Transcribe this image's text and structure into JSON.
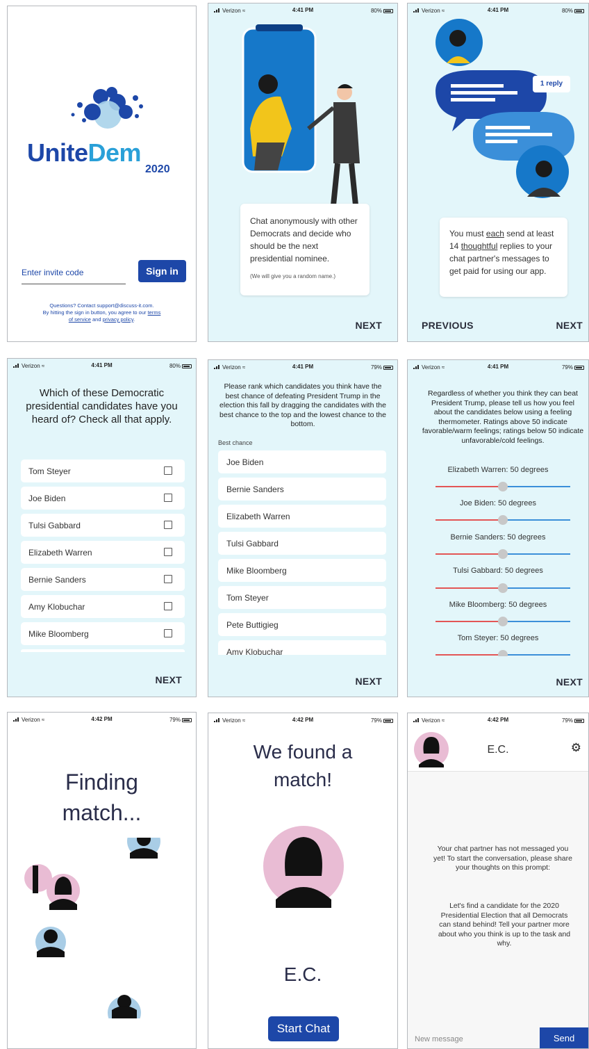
{
  "colors": {
    "brand": "#1d47a8",
    "light_bg": "#e3f6fa",
    "pink": "#e9bcd4",
    "blue_avatar": "#a9cde6",
    "slider_red": "#e35555",
    "slider_blue": "#3b8fd9"
  },
  "status": {
    "carrier": "Verizon",
    "time_441": "4:41 PM",
    "time_442": "4:42 PM",
    "batt_80": "80%",
    "batt_79": "79%"
  },
  "login": {
    "brand_part1": "Unite",
    "brand_part2": "Dem",
    "year": "2020",
    "invite_placeholder": "Enter invite code",
    "signin": "Sign in",
    "footer_line1": "Questions? Contact support@discuss-it.com.",
    "footer_line2a": "By hitting the sign in button, you agree to our ",
    "terms": "terms",
    "footer_line3a": "of service",
    "footer_line3b": " and ",
    "privacy": "privacy policy",
    "period": "."
  },
  "onboard1": {
    "text": "Chat anonymously with other Democrats and decide who should be the next presidential nominee.",
    "note": "(We will give you a random name.)",
    "next": "NEXT"
  },
  "onboard2": {
    "reply_badge": "1 reply",
    "t1": "You must ",
    "each": "each",
    "t2": " send at least 14 ",
    "thoughtful": "thoughtful",
    "t3": " replies to your chat partner's messages to get paid for using our app.",
    "previous": "PREVIOUS",
    "next": "NEXT"
  },
  "heard": {
    "question": "Which of these Democratic presidential candidates have you heard of? Check all that apply.",
    "candidates": [
      "Tom Steyer",
      "Joe Biden",
      "Tulsi Gabbard",
      "Elizabeth Warren",
      "Bernie Sanders",
      "Amy Klobuchar",
      "Mike Bloomberg"
    ],
    "next": "NEXT"
  },
  "rank": {
    "instructions": "Please rank which candidates you think have the best chance of defeating President Trump in the election this fall by dragging the candidates with the best chance to the top and the lowest chance to the bottom.",
    "best_chance": "Best chance",
    "candidates": [
      "Joe Biden",
      "Bernie Sanders",
      "Elizabeth Warren",
      "Tulsi Gabbard",
      "Mike Bloomberg",
      "Tom Steyer",
      "Pete Buttigieg",
      "Amy Klobuchar"
    ],
    "next": "NEXT"
  },
  "thermo": {
    "instructions": "Regardless of whether you think they can beat President Trump, please tell us how you feel about the candidates below using a feeling thermometer. Ratings above 50 indicate favorable/warm feelings; ratings below 50 indicate unfavorable/cold feelings.",
    "items": [
      {
        "label": "Elizabeth Warren: 50 degrees",
        "value": 50
      },
      {
        "label": "Joe Biden: 50 degrees",
        "value": 50
      },
      {
        "label": "Bernie Sanders: 50 degrees",
        "value": 50
      },
      {
        "label": "Tulsi Gabbard: 50 degrees",
        "value": 50
      },
      {
        "label": "Mike Bloomberg: 50 degrees",
        "value": 50
      },
      {
        "label": "Tom Steyer: 50 degrees",
        "value": 50
      }
    ],
    "next": "NEXT"
  },
  "finding": {
    "line1": "Finding",
    "line2": "match..."
  },
  "found": {
    "line1": "We found a",
    "line2": "match!",
    "name": "E.C.",
    "start": "Start Chat"
  },
  "chat": {
    "name": "E.C.",
    "prompt1": "Your chat partner has not messaged you yet! To start the conversation, please share your thoughts on this prompt:",
    "prompt2": "Let's find a candidate for the 2020 Presidential Election that all Democrats can stand behind! Tell your partner more about who you think is up to the task and why.",
    "placeholder": "New message",
    "send": "Send"
  }
}
